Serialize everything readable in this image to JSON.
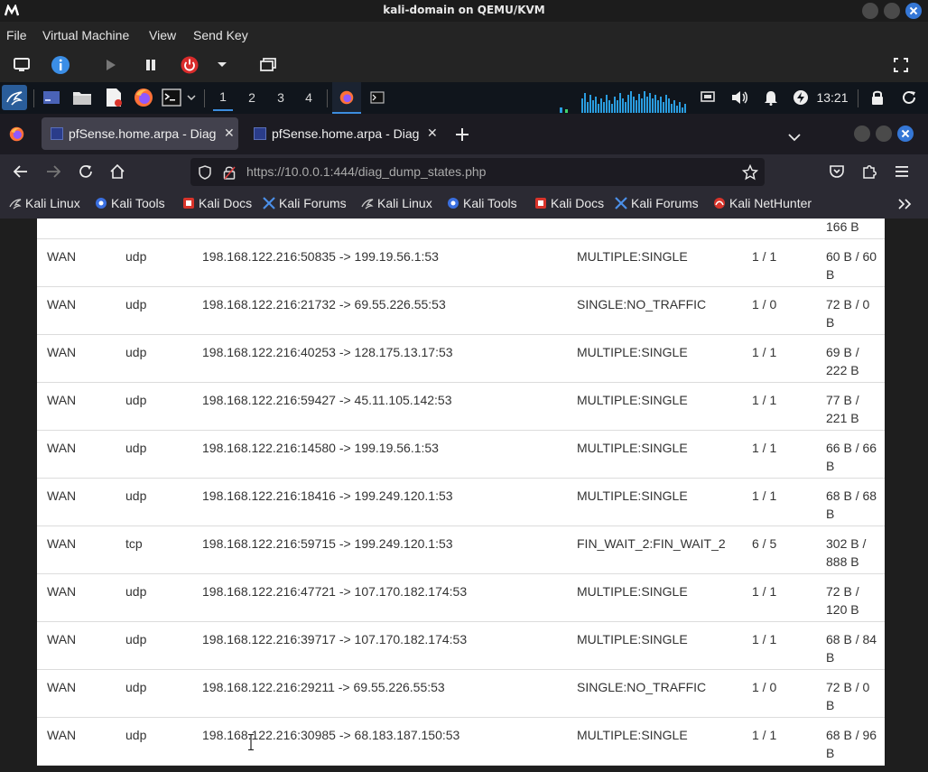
{
  "window": {
    "title": "kali-domain on QEMU/KVM"
  },
  "qemu_menu": [
    "File",
    "Virtual Machine",
    "View",
    "Send Key"
  ],
  "kali_panel": {
    "workspaces": [
      "1",
      "2",
      "3",
      "4"
    ],
    "active_workspace": "1",
    "clock": "13:21"
  },
  "browser": {
    "tabs": [
      {
        "title": "pfSense.home.arpa - Diag",
        "active": true
      },
      {
        "title": "pfSense.home.arpa - Diag",
        "active": false
      }
    ],
    "url_host": "https://10.0.0.1",
    "url_rest": ":444/diag_dump_states.php",
    "bookmarks": [
      {
        "label": "Kali Linux",
        "icon": "kali-icon"
      },
      {
        "label": "Kali Tools",
        "icon": "kali-tools-icon"
      },
      {
        "label": "Kali Docs",
        "icon": "kali-docs-icon"
      },
      {
        "label": "Kali Forums",
        "icon": "kali-forums-icon"
      },
      {
        "label": "Kali Linux",
        "icon": "kali-icon"
      },
      {
        "label": "Kali Tools",
        "icon": "kali-tools-icon"
      },
      {
        "label": "Kali Docs",
        "icon": "kali-docs-icon"
      },
      {
        "label": "Kali Forums",
        "icon": "kali-forums-icon"
      },
      {
        "label": "Kali NetHunter",
        "icon": "nethunter-icon"
      }
    ]
  },
  "states_table": {
    "partial_top_bytes": "166 B",
    "rows": [
      {
        "if": "WAN",
        "proto": "udp",
        "src_dst": "198.168.122.216:50835 -> 199.19.56.1:53",
        "state": "MULTIPLE:SINGLE",
        "packets": "1 / 1",
        "bytes": "60 B / 60 B"
      },
      {
        "if": "WAN",
        "proto": "udp",
        "src_dst": "198.168.122.216:21732 -> 69.55.226.55:53",
        "state": "SINGLE:NO_TRAFFIC",
        "packets": "1 / 0",
        "bytes": "72 B / 0 B"
      },
      {
        "if": "WAN",
        "proto": "udp",
        "src_dst": "198.168.122.216:40253 -> 128.175.13.17:53",
        "state": "MULTIPLE:SINGLE",
        "packets": "1 / 1",
        "bytes": "69 B / 222 B"
      },
      {
        "if": "WAN",
        "proto": "udp",
        "src_dst": "198.168.122.216:59427 -> 45.11.105.142:53",
        "state": "MULTIPLE:SINGLE",
        "packets": "1 / 1",
        "bytes": "77 B / 221 B"
      },
      {
        "if": "WAN",
        "proto": "udp",
        "src_dst": "198.168.122.216:14580 -> 199.19.56.1:53",
        "state": "MULTIPLE:SINGLE",
        "packets": "1 / 1",
        "bytes": "66 B / 66 B"
      },
      {
        "if": "WAN",
        "proto": "udp",
        "src_dst": "198.168.122.216:18416 -> 199.249.120.1:53",
        "state": "MULTIPLE:SINGLE",
        "packets": "1 / 1",
        "bytes": "68 B / 68 B"
      },
      {
        "if": "WAN",
        "proto": "tcp",
        "src_dst": "198.168.122.216:59715 -> 199.249.120.1:53",
        "state": "FIN_WAIT_2:FIN_WAIT_2",
        "packets": "6 / 5",
        "bytes": "302 B / 888 B"
      },
      {
        "if": "WAN",
        "proto": "udp",
        "src_dst": "198.168.122.216:47721 -> 107.170.182.174:53",
        "state": "MULTIPLE:SINGLE",
        "packets": "1 / 1",
        "bytes": "72 B / 120 B"
      },
      {
        "if": "WAN",
        "proto": "udp",
        "src_dst": "198.168.122.216:39717 -> 107.170.182.174:53",
        "state": "MULTIPLE:SINGLE",
        "packets": "1 / 1",
        "bytes": "68 B / 84 B"
      },
      {
        "if": "WAN",
        "proto": "udp",
        "src_dst": "198.168.122.216:29211 -> 69.55.226.55:53",
        "state": "SINGLE:NO_TRAFFIC",
        "packets": "1 / 0",
        "bytes": "72 B / 0 B"
      },
      {
        "if": "WAN",
        "proto": "udp",
        "src_dst": "198.168.122.216:30985 -> 68.183.187.150:53",
        "state": "MULTIPLE:SINGLE",
        "packets": "1 / 1",
        "bytes": "68 B / 96 B"
      }
    ]
  }
}
